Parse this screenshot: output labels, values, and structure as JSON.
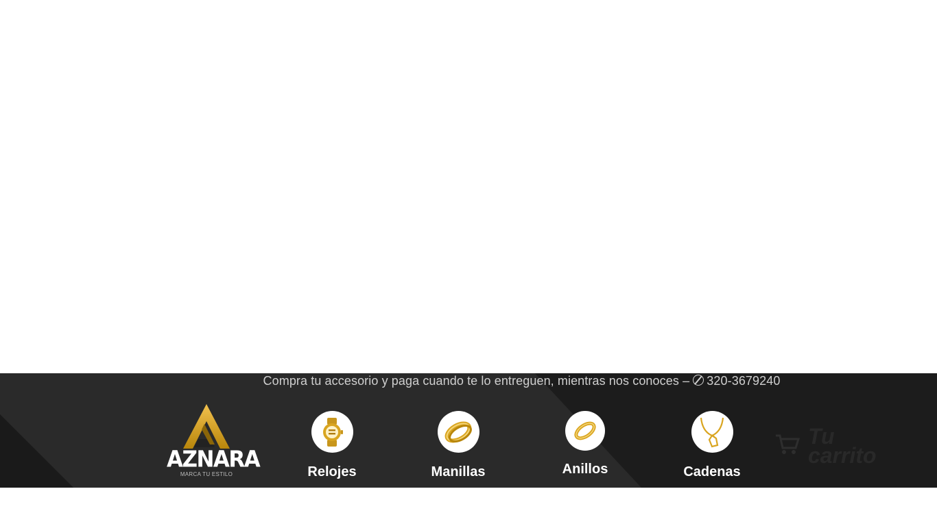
{
  "header": {
    "promo_text": "Compra tu accesorio y paga cuando te lo entreguen, mientras nos conoces – ",
    "phone": "320-3679240"
  },
  "logo": {
    "name": "AZNARA",
    "tagline": "MARCA TU ESTILO"
  },
  "categories": [
    {
      "label": "Relojes",
      "icon": "watch-icon"
    },
    {
      "label": "Manillas",
      "icon": "bracelet-icon"
    },
    {
      "label": "Anillos",
      "icon": "ring-icon"
    },
    {
      "label": "Cadenas",
      "icon": "chain-icon"
    }
  ],
  "cart": {
    "label_line1": "Tu",
    "label_line2": "carrito",
    "icon": "cart-icon"
  },
  "colors": {
    "gold": "#d4a017",
    "bar_background": "#1c1c1c",
    "text_light": "#cfcfcf"
  }
}
